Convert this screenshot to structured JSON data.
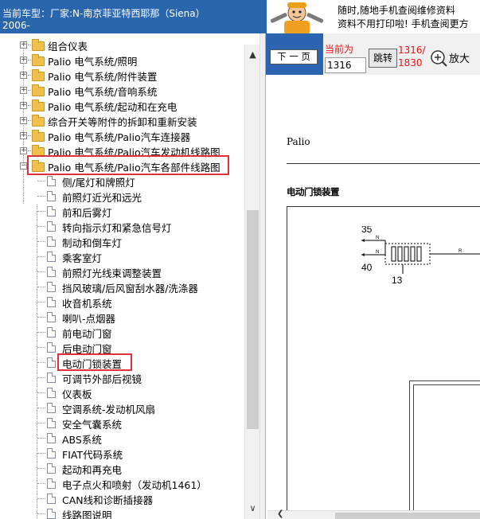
{
  "header": {
    "car_label": "当前车型：厂家:N-南京菲亚特西耶那（Siena）",
    "year": "2006-"
  },
  "banner": {
    "line1": "随时,随地手机查阅维修资料",
    "line2": "资料不用打印啦! 手机查阅更方"
  },
  "tree": {
    "folders": [
      {
        "label": "组合仪表"
      },
      {
        "label": "Palio 电气系统/照明"
      },
      {
        "label": "Palio 电气系统/附件装置"
      },
      {
        "label": "Palio 电气系统/音响系统"
      },
      {
        "label": "Palio 电气系统/起动和在充电"
      },
      {
        "label": "综合开关等附件的拆卸和重新安装"
      },
      {
        "label": "Palio 电气系统/Palio汽车连接器"
      },
      {
        "label": "Palio 电气系统/Palio汽车发动机线路图"
      }
    ],
    "open_folder": {
      "label": "Palio 电气系统/Palio汽车各部件线路图"
    },
    "items": [
      {
        "label": "侧/尾灯和牌照灯"
      },
      {
        "label": "前照灯近光和远光"
      },
      {
        "label": "前和后雾灯"
      },
      {
        "label": "转向指示灯和紧急信号灯"
      },
      {
        "label": "制动和倒车灯"
      },
      {
        "label": "乘客室灯"
      },
      {
        "label": "前照灯光线束调整装置"
      },
      {
        "label": "挡风玻璃/后风窗刮水器/洗涤器"
      },
      {
        "label": "收音机系统"
      },
      {
        "label": "喇叭-点烟器"
      },
      {
        "label": "前电动门窗"
      },
      {
        "label": "后电动门窗"
      },
      {
        "label": "电动门锁装置"
      },
      {
        "label": "可调节外部后视镜"
      },
      {
        "label": "仪表板"
      },
      {
        "label": "空调系统-发动机风扇"
      },
      {
        "label": "安全气囊系统"
      },
      {
        "label": "ABS系统"
      },
      {
        "label": "FIAT代码系统"
      },
      {
        "label": "起动和再充电"
      },
      {
        "label": "电子点火和喷射（发动机1461）"
      },
      {
        "label": "CAN线和诊断插接器"
      },
      {
        "label": "线路图说明"
      }
    ],
    "selected": "电动门锁装置"
  },
  "toolbar": {
    "next_page": "下 一 页",
    "current_label": "当前为",
    "page_input": "1316",
    "jump": "跳转",
    "total_a": "1316/",
    "total_b": "1830",
    "zoom": "放大"
  },
  "document": {
    "page_title": "Palio",
    "section_title": "电动门锁装置",
    "diagram": {
      "n35": "35",
      "n40": "40",
      "n13": "13",
      "pin_n1": "N",
      "pin_n2": "N",
      "pin_r": "R"
    }
  },
  "colors": {
    "header_blue": "#2a66ad",
    "highlight_red": "#e0303a",
    "page_red": "#e11"
  }
}
